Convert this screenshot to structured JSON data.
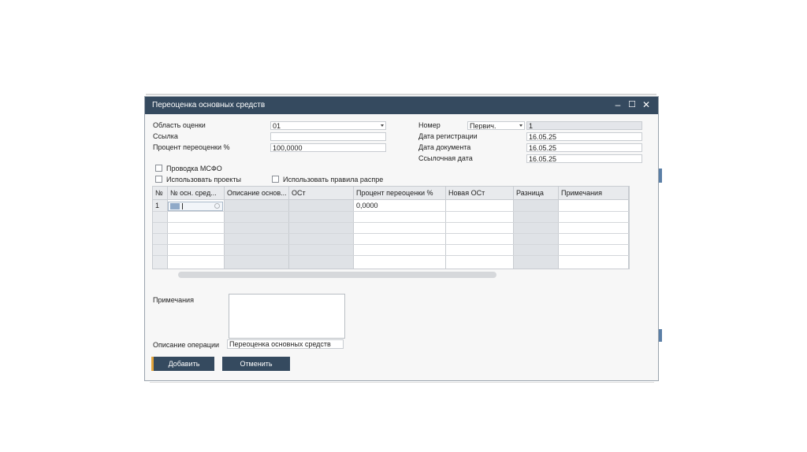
{
  "window": {
    "title": "Переоценка основных средств"
  },
  "titlebar_controls": {
    "minimize": "–",
    "maximize": "☐",
    "close": "✕"
  },
  "form": {
    "area_label": "Область оценки",
    "area_value": "01",
    "ref_label": "Ссылка",
    "ref_value": "",
    "percent_label": "Процент переоценки %",
    "percent_value": "100,0000",
    "number_label": "Номер",
    "number_series": "Первич.",
    "number_value": "1",
    "reg_date_label": "Дата регистрации",
    "reg_date_value": "16.05.25",
    "doc_date_label": "Дата документа",
    "doc_date_value": "16.05.25",
    "ref_date_label": "Ссылочная дата",
    "ref_date_value": "16.05.25",
    "msfo_label": "Проводка МСФО",
    "projects_label": "Использовать проекты",
    "dist_rules_label": "Использовать правила распре"
  },
  "grid": {
    "columns": [
      "№",
      "№ осн. сред...",
      "Описание основ...",
      "ОСт",
      "Процент переоценки %",
      "Новая ОСт",
      "Разница",
      "Примечания"
    ],
    "rows": [
      {
        "num": "1",
        "percent": "0,0000"
      }
    ]
  },
  "bottom": {
    "remarks_label": "Примечания",
    "remarks_value": "",
    "op_desc_label": "Описание операции",
    "op_desc_value": "Переоценка основных средств"
  },
  "buttons": {
    "add": "Добавить",
    "cancel": "Отменить"
  },
  "colors": {
    "titlebar": "#354a5f",
    "button": "#354a5f",
    "accent": "#e1a33a"
  }
}
